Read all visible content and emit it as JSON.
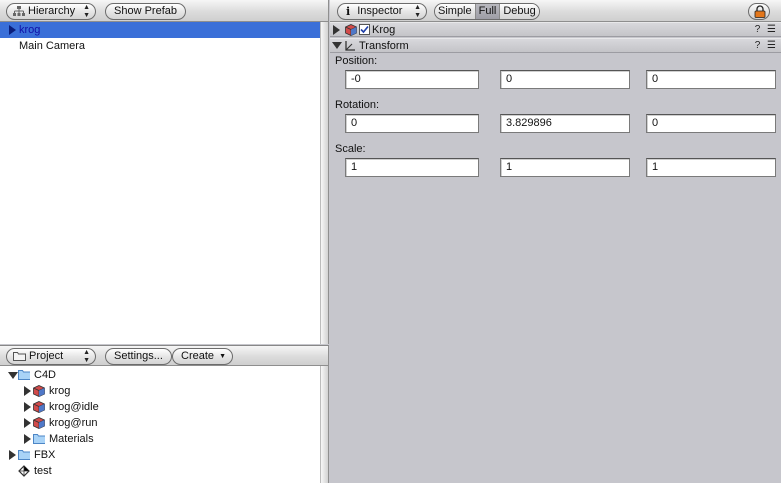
{
  "hierarchy": {
    "title": "Hierarchy",
    "show_prefab_label": "Show Prefab",
    "items": [
      {
        "label": "krog",
        "selected": true,
        "expandable": true
      },
      {
        "label": "Main Camera",
        "selected": false,
        "expandable": false
      }
    ]
  },
  "project": {
    "title": "Project",
    "settings_label": "Settings...",
    "create_label": "Create",
    "items": [
      {
        "label": "C4D",
        "type": "folder",
        "expanded": true,
        "indent": 0
      },
      {
        "label": "krog",
        "type": "model",
        "expanded": false,
        "indent": 1
      },
      {
        "label": "krog@idle",
        "type": "model",
        "expanded": false,
        "indent": 1
      },
      {
        "label": "krog@run",
        "type": "model",
        "expanded": false,
        "indent": 1
      },
      {
        "label": "Materials",
        "type": "folder",
        "expanded": false,
        "indent": 1
      },
      {
        "label": "FBX",
        "type": "folder",
        "expanded": false,
        "indent": 0
      },
      {
        "label": "test",
        "type": "scene",
        "expanded": false,
        "indent": 0
      }
    ]
  },
  "inspector": {
    "title": "Inspector",
    "modes": [
      "Simple",
      "Full",
      "Debug"
    ],
    "active_mode": "Full",
    "object": {
      "name": "Krog",
      "enabled": true
    },
    "transform": {
      "title": "Transform",
      "position_label": "Position:",
      "position": [
        "-0",
        "0",
        "0"
      ],
      "rotation_label": "Rotation:",
      "rotation": [
        "0",
        "3.829896",
        "0"
      ],
      "scale_label": "Scale:",
      "scale": [
        "1",
        "1",
        "1"
      ]
    },
    "help_glyph": "?"
  },
  "colors": {
    "selection": "#3a6fd8",
    "selected_text": "#1010a8",
    "panel_bg": "#c6c6cc",
    "lock_accent": "#e3761a"
  }
}
